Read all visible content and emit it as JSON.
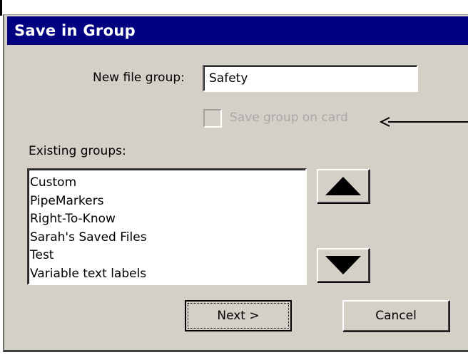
{
  "dialog": {
    "title": "Save in Group",
    "new_file_group_label": "New file group:",
    "new_file_group_value": "Safety",
    "save_on_card_label": "Save group on card",
    "save_on_card_checked": false,
    "save_on_card_enabled": false,
    "existing_groups_label": "Existing groups:",
    "existing_groups": [
      "Custom",
      "PipeMarkers",
      "Right-To-Know",
      "Sarah's Saved Files",
      "Test",
      "Variable text labels"
    ],
    "next_label": "Next >",
    "cancel_label": "Cancel"
  },
  "icons": {
    "scroll_up": "up-triangle-icon",
    "scroll_down": "down-triangle-icon",
    "callout": "callout-arrow-icon"
  },
  "colors": {
    "titlebar": "#000080",
    "titlebar_text": "#ffffff",
    "dialog_bg": "#d4d0c8",
    "disabled_text": "#a8a8a8"
  }
}
